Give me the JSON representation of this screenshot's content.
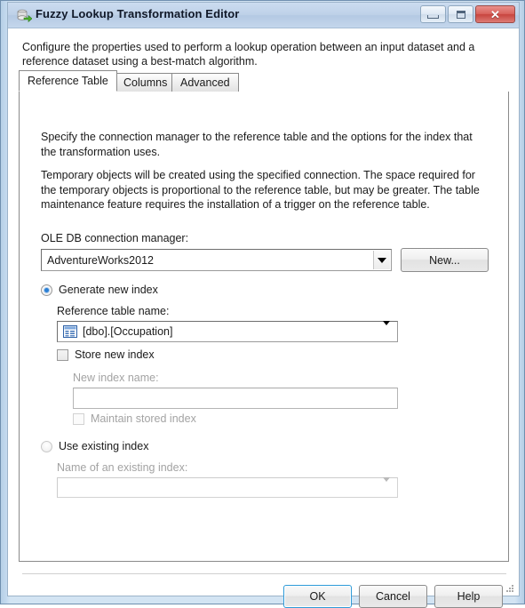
{
  "window": {
    "title": "Fuzzy Lookup Transformation Editor",
    "icon": "fuzzy-lookup-icon",
    "controls": {
      "minimize": "minimize-button",
      "maximize": "maximize-button",
      "close": "close-button",
      "close_glyph": "✕"
    },
    "resize_grip": "resize-grip"
  },
  "intro": "Configure the properties used to perform a lookup operation between an input dataset and a reference dataset using a best-match algorithm.",
  "tabs": [
    {
      "label": "Reference Table",
      "selected": true
    },
    {
      "label": "Columns",
      "selected": false
    },
    {
      "label": "Advanced",
      "selected": false
    }
  ],
  "page": {
    "description_1": "Specify the connection manager to the reference table and the options for the index that the transformation uses.",
    "description_2": "Temporary objects will be created using the specified connection. The space required for the temporary objects is proportional to the reference table, but may be greater. The table maintenance feature requires the installation of a trigger on the reference table.",
    "connection_manager": {
      "label": "OLE DB connection manager:",
      "value": "AdventureWorks2012",
      "new_button": "New..."
    },
    "generate_new_index": {
      "label": "Generate new index",
      "selected": true,
      "reference_table": {
        "label": "Reference table name:",
        "value": "[dbo].[Occupation]",
        "icon": "table-icon"
      },
      "store_new_index": {
        "label": "Store new index",
        "checked": false
      },
      "new_index_name": {
        "label": "New index name:",
        "value": "",
        "enabled": false
      },
      "maintain_stored_index": {
        "label": "Maintain stored index",
        "checked": false,
        "enabled": false
      }
    },
    "use_existing_index": {
      "label": "Use existing index",
      "selected": false,
      "existing_index_name": {
        "label": "Name of an existing index:",
        "value": "",
        "enabled": false
      }
    }
  },
  "footer": {
    "ok": "OK",
    "cancel": "Cancel",
    "help": "Help"
  },
  "colors": {
    "accent": "#2f9bd8",
    "radio_dot": "#2a7fd4",
    "titlebar": "#bed1e8",
    "close_button": "#c7453f"
  }
}
